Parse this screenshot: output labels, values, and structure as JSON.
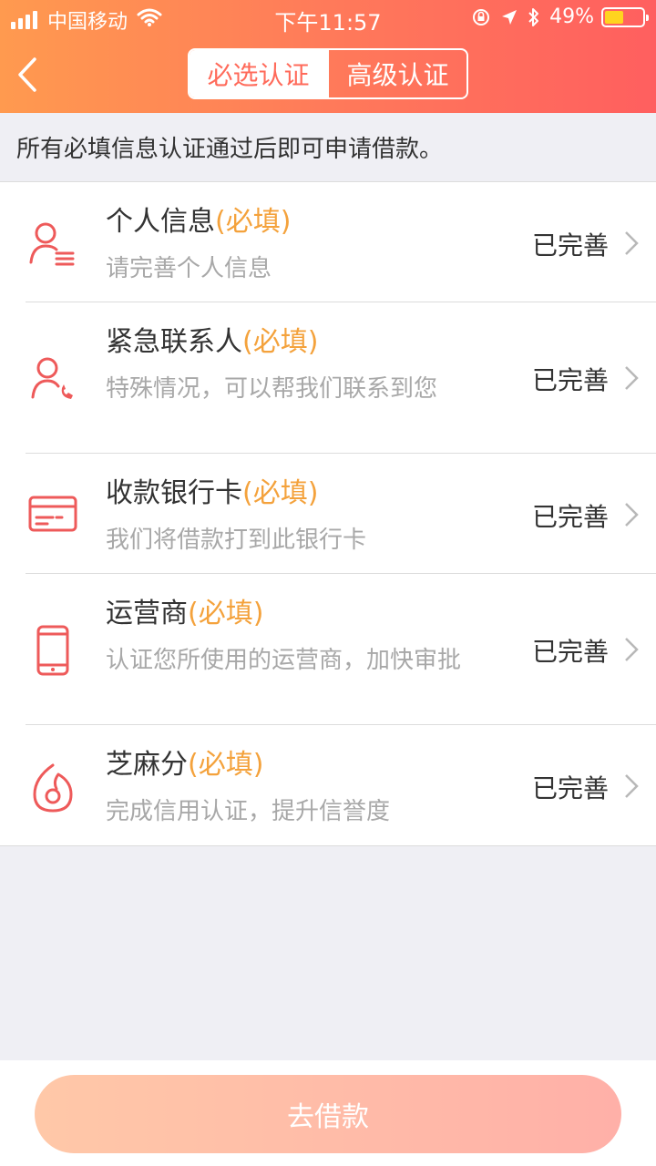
{
  "status_bar": {
    "carrier": "中国移动",
    "time": "下午11:57",
    "battery": "49%"
  },
  "nav": {
    "tabs": [
      {
        "label": "必选认证",
        "active": true
      },
      {
        "label": "高级认证",
        "active": false
      }
    ]
  },
  "notice": "所有必填信息认证通过后即可申请借款。",
  "items": [
    {
      "title": "个人信息",
      "required": "(必填)",
      "subtitle": "请完善个人信息",
      "status": "已完善",
      "icon": "user-list-icon"
    },
    {
      "title": "紧急联系人",
      "required": "(必填)",
      "subtitle": "特殊情况，可以帮我们联系到您",
      "status": "已完善",
      "icon": "contact-phone-icon"
    },
    {
      "title": "收款银行卡",
      "required": "(必填)",
      "subtitle": "我们将借款打到此银行卡",
      "status": "已完善",
      "icon": "bank-card-icon"
    },
    {
      "title": "运营商",
      "required": "(必填)",
      "subtitle": "认证您所使用的运营商，加快审批",
      "status": "已完善",
      "icon": "mobile-phone-icon"
    },
    {
      "title": "芝麻分",
      "required": "(必填)",
      "subtitle": "完成信用认证，提升信誉度",
      "status": "已完善",
      "icon": "sesame-icon"
    }
  ],
  "cta": {
    "label": "去借款"
  },
  "colors": {
    "accent": "#ff6a5a",
    "required": "#f4a23c",
    "icon": "#ee5a5a"
  }
}
